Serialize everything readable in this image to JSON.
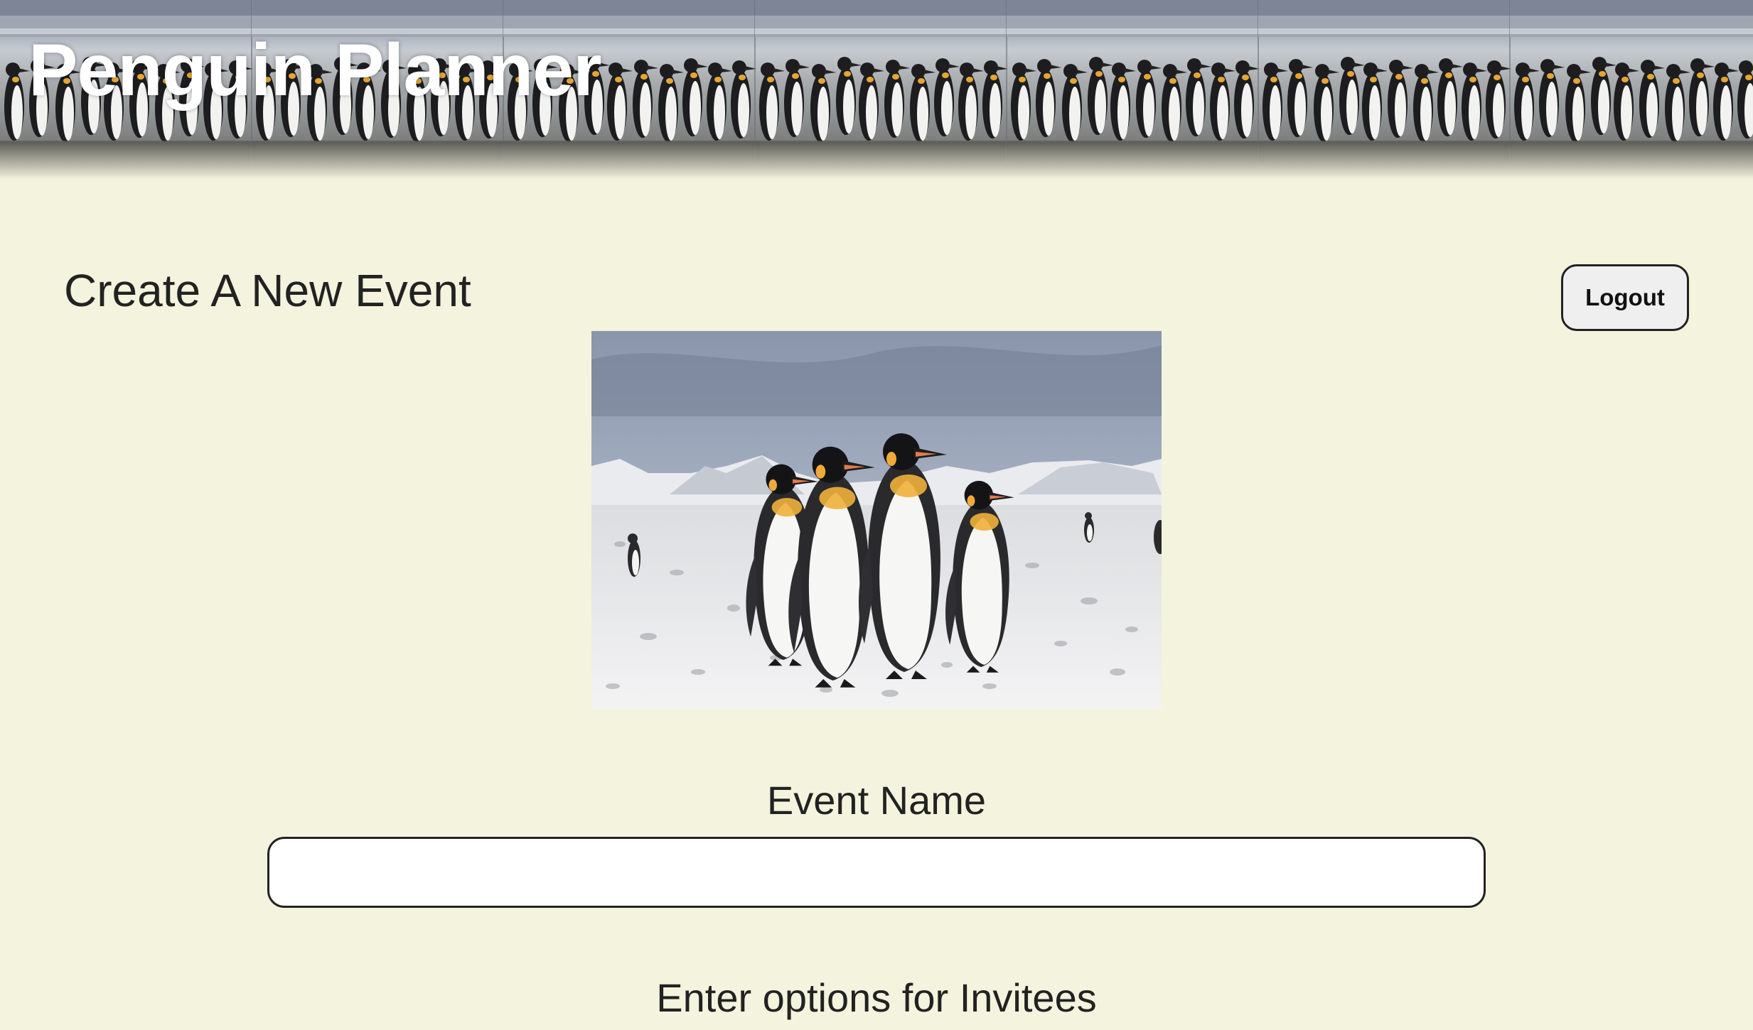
{
  "header": {
    "site_title": "Penguin Planner"
  },
  "page": {
    "heading": "Create A New Event",
    "logout_label": "Logout"
  },
  "hero_image": {
    "subject": "king penguins on snowy beach with mountains",
    "icon": "penguin-photo"
  },
  "form": {
    "event_name_label": "Event Name",
    "event_name_value": "",
    "event_name_placeholder": "",
    "invitee_options_label": "Enter options for Invitees"
  },
  "colors": {
    "page_background": "#f4f3de",
    "title_text": "#ffffff",
    "button_background": "#efefef",
    "text": "#222222"
  }
}
